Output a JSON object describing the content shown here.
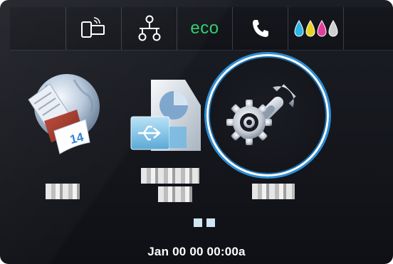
{
  "status_bar": {
    "items": [
      {
        "icon": "wireless-direct-icon"
      },
      {
        "icon": "network-icon"
      },
      {
        "label": "eco",
        "icon": "eco-icon",
        "color": "#2ecf6e"
      },
      {
        "icon": "phone-icon"
      },
      {
        "icon": "ink-levels-icon",
        "colors": [
          "#2bb6e8",
          "#e6d321",
          "#e23d9a",
          "#cfcfcf"
        ]
      }
    ]
  },
  "apps": [
    {
      "name": "calendar-app",
      "label": "",
      "badge": "14"
    },
    {
      "name": "copy-scan-app",
      "label": ""
    },
    {
      "name": "setup-app",
      "label": "",
      "selected": true
    }
  ],
  "pager": {
    "pages": 2,
    "current": 1
  },
  "footer": {
    "datetime": "Jan 00 00 00:00a"
  },
  "colors": {
    "accent_ring": "#2a8fd8",
    "background": "#15171d"
  }
}
